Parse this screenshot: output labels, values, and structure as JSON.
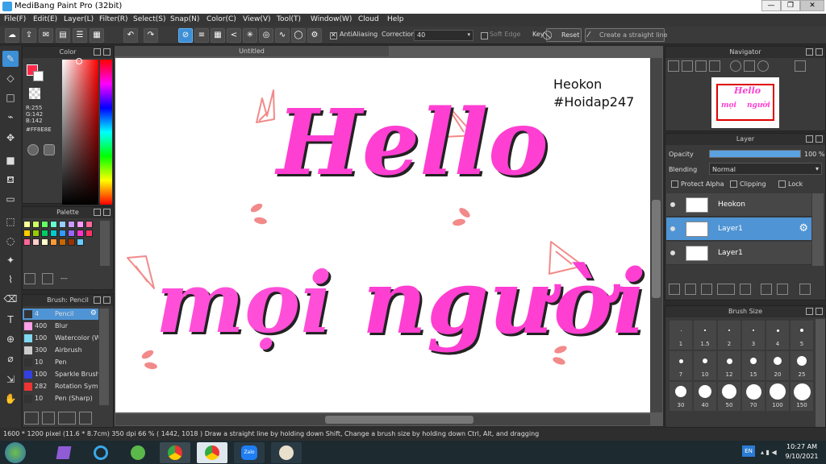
{
  "window": {
    "title": "MediBang Paint Pro (32bit)"
  },
  "menu": [
    "File(F)",
    "Edit(E)",
    "Layer(L)",
    "Filter(R)",
    "Select(S)",
    "Snap(N)",
    "Color(C)",
    "View(V)",
    "Tool(T)",
    "Window(W)",
    "Cloud",
    "Help"
  ],
  "toolbar": {
    "antialiasing_label": "AntiAliasing",
    "correction_label": "Correction",
    "correction_value": "40",
    "soft_edge_label": "Soft Edge",
    "key_label": "Key",
    "reset_label": "Reset",
    "straight_line_label": "Create a straight line"
  },
  "color_panel": {
    "title": "Color",
    "r": "R:255",
    "g": "G:142",
    "b": "B:142",
    "hex": "#FF8E8E",
    "primary_color": "#ff2a4a"
  },
  "palette_panel": {
    "title": "Palette",
    "dash": "---",
    "swatches": [
      "#ffff99",
      "#ccff66",
      "#66ff66",
      "#66ffcc",
      "#99ccff",
      "#cc99ff",
      "#ff99ff",
      "#ff6699",
      "#ffcc00",
      "#99cc00",
      "#00cc66",
      "#00cccc",
      "#3399ff",
      "#9966ff",
      "#ff33cc",
      "#ff3366",
      "#ff6699",
      "#ffcccc",
      "#ffffcc",
      "#ff9933",
      "#cc6600",
      "#993300",
      "#66ccff"
    ]
  },
  "brush_panel": {
    "title": "Brush: Pencil",
    "items": [
      {
        "size": "4",
        "name": "Pencil",
        "color": "#333333"
      },
      {
        "size": "400",
        "name": "Blur",
        "color": "#ff9fe8"
      },
      {
        "size": "100",
        "name": "Watercolor (W",
        "color": "#7fd8f0"
      },
      {
        "size": "300",
        "name": "Airbrush",
        "color": "#cccccc"
      },
      {
        "size": "10",
        "name": "Pen",
        "color": "#333333"
      },
      {
        "size": "100",
        "name": "Sparkle Brush",
        "color": "#3340e0"
      },
      {
        "size": "282",
        "name": "Rotation Sym",
        "color": "#ee3333"
      },
      {
        "size": "10",
        "name": "Pen (Sharp)",
        "color": "#333333"
      }
    ]
  },
  "canvas": {
    "tab_title": "Untitled",
    "signature_line1": "Heokon",
    "signature_line2": "#Hoidap247",
    "word_hello": "Hello",
    "word_moi": "mọi",
    "word_nguoi": "người"
  },
  "navigator": {
    "title": "Navigator"
  },
  "layer_panel": {
    "title": "Layer",
    "opacity_label": "Opacity",
    "opacity_value": "100 %",
    "opacity_fraction": 1.0,
    "blending_label": "Blending",
    "blending_value": "Normal",
    "protect_alpha": "Protect Alpha",
    "clipping": "Clipping",
    "lock": "Lock",
    "layers": [
      {
        "name": "Heokon",
        "selected": false
      },
      {
        "name": "Layer1",
        "selected": true
      },
      {
        "name": "Layer1",
        "selected": false
      }
    ]
  },
  "brush_size_panel": {
    "title": "Brush Size",
    "sizes": [
      "1",
      "1.5",
      "2",
      "3",
      "4",
      "5",
      "7",
      "10",
      "12",
      "15",
      "20",
      "25",
      "30",
      "40",
      "50",
      "70",
      "100",
      "150"
    ]
  },
  "status": {
    "text": "1600 * 1200 pixel   (11.6 * 8.7cm)   350 dpi   66 %   ( 1442, 1018 )   Draw a straight line by holding down Shift, Change a brush size by holding down Ctrl, Alt, and dragging"
  },
  "taskbar": {
    "zalo_label": "Zalo",
    "lang": "EN",
    "time": "10:27 AM",
    "date": "9/10/2021"
  }
}
